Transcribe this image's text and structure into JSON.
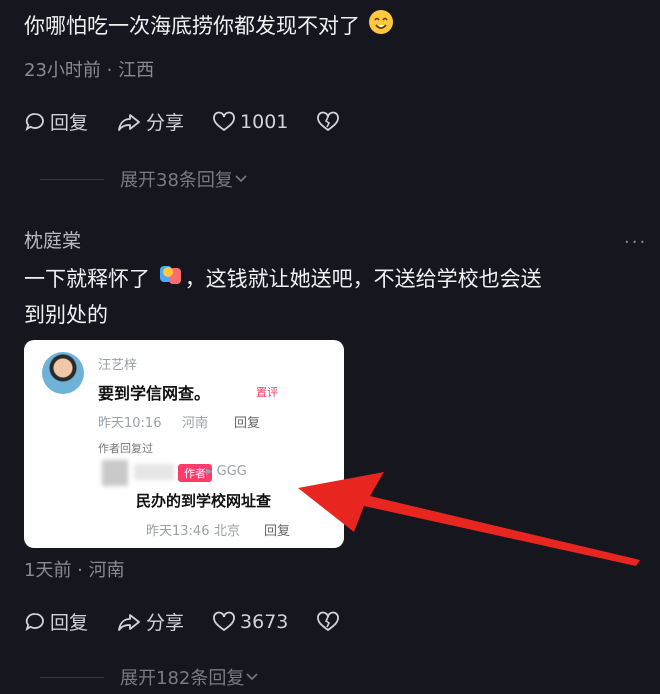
{
  "comment1": {
    "text": "你哪怕吃一次海底捞你都发现不对了",
    "meta": "23小时前 · 江西",
    "reply_label": "回复",
    "share_label": "分享",
    "like_count": "1001",
    "expand_label": "展开38条回复"
  },
  "comment2": {
    "username": "枕庭棠",
    "more": "···",
    "text_line1_a": "一下就释怀了",
    "text_line1_b": "，这钱就让她送吧，不送给学校也会送",
    "text_line2": "到别处的",
    "meta": "1天前 · 河南",
    "reply_label": "回复",
    "share_label": "分享",
    "like_count": "3673",
    "expand_label": "展开182条回复"
  },
  "card": {
    "name": "汪艺梓",
    "content": "要到学信网查。",
    "badge": "置评",
    "time": "昨天10:16",
    "location": "河南",
    "reply": "回复",
    "tag": "作者回复过",
    "author_tag": "作者",
    "reply_to": "▸ GGG",
    "content2": "民办的到学校网址查",
    "time2": "昨天13:46",
    "location2": "北京",
    "reply2": "回复"
  },
  "colors": {
    "background": "#16161e",
    "arrow": "#e8261f"
  }
}
